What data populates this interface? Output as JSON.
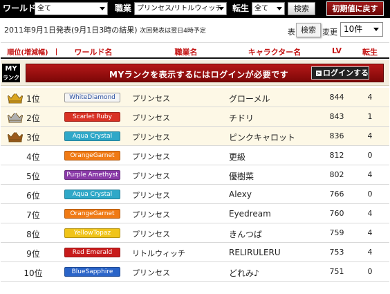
{
  "filters": {
    "world_label": "ワールド",
    "world_value": "全て",
    "job_label": "職業",
    "job_value": "プリンセス/リトルウィッチ",
    "reinc_label": "転生",
    "reinc_value": "全て",
    "search_label": "検索",
    "reset_label": "初期値に戻す"
  },
  "info": {
    "announce": "2011年9月1日発表",
    "result_time": "(9月1日3時の結果)",
    "next_notice": "次回発表は翌日4時予定",
    "per_prefix": "表",
    "per_suffix": "変更",
    "tooltip": "検索",
    "per_page": "10件"
  },
  "header": {
    "rank": "順位(増減幅)",
    "world": "ワールド名",
    "job": "職業名",
    "character": "キャラクター名",
    "lv": "LV",
    "reinc": "転生"
  },
  "myrank": {
    "badge_top": "MY",
    "badge_bottom": "ランク",
    "message": "MYランクを表示するにはログインが必要です",
    "login_label": "ログインする"
  },
  "colors": {
    "accent_red": "#c41414",
    "gold_crown": "#d9a520",
    "silver_crown": "#b0b0b0",
    "bronze_crown": "#9a5a1c"
  },
  "rows": [
    {
      "rank": "1位",
      "crown": "gold-crown-icon",
      "world": "WhiteDiamond",
      "world_bg": "#f4f4f4",
      "world_fg": "#2a4fa0",
      "job": "プリンセス",
      "character": "グローメル",
      "lv": "844",
      "reinc": "4"
    },
    {
      "rank": "2位",
      "crown": "silver-crown-icon",
      "world": "Scarlet Ruby",
      "world_bg": "#d93224",
      "world_fg": "#ffffff",
      "job": "プリンセス",
      "character": "チドリ",
      "lv": "843",
      "reinc": "1"
    },
    {
      "rank": "3位",
      "crown": "bronze-crown-icon",
      "world": "Aqua Crystal",
      "world_bg": "#2fa8c8",
      "world_fg": "#ffffff",
      "job": "プリンセス",
      "character": "ピンクキャロット",
      "lv": "836",
      "reinc": "4"
    },
    {
      "rank": "4位",
      "world": "OrangeGarnet",
      "world_bg": "#f07a14",
      "world_fg": "#ffffff",
      "job": "プリンセス",
      "character": "更級",
      "lv": "812",
      "reinc": "0"
    },
    {
      "rank": "5位",
      "world": "Purple Amethyst",
      "world_bg": "#8a3aa8",
      "world_fg": "#ffffff",
      "job": "プリンセス",
      "character": "優樹菜",
      "lv": "802",
      "reinc": "4"
    },
    {
      "rank": "6位",
      "world": "Aqua Crystal",
      "world_bg": "#2fa8c8",
      "world_fg": "#ffffff",
      "job": "プリンセス",
      "character": "Alexy",
      "lv": "766",
      "reinc": "0"
    },
    {
      "rank": "7位",
      "world": "OrangeGarnet",
      "world_bg": "#f07a14",
      "world_fg": "#ffffff",
      "job": "プリンセス",
      "character": "Eyedream",
      "lv": "760",
      "reinc": "4"
    },
    {
      "rank": "8位",
      "world": "YellowTopaz",
      "world_bg": "#f0c418",
      "world_fg": "#ffffff",
      "job": "プリンセス",
      "character": "きんつば",
      "lv": "759",
      "reinc": "4"
    },
    {
      "rank": "9位",
      "world": "Red Emerald",
      "world_bg": "#c81c1c",
      "world_fg": "#ffffff",
      "job": "リトルウィッチ",
      "character": "RELIRULERU",
      "lv": "753",
      "reinc": "4"
    },
    {
      "rank": "10位",
      "world": "BlueSapphire",
      "world_bg": "#2a64c8",
      "world_fg": "#ffffff",
      "job": "プリンセス",
      "character": "どれみ♪",
      "lv": "751",
      "reinc": "0"
    }
  ]
}
